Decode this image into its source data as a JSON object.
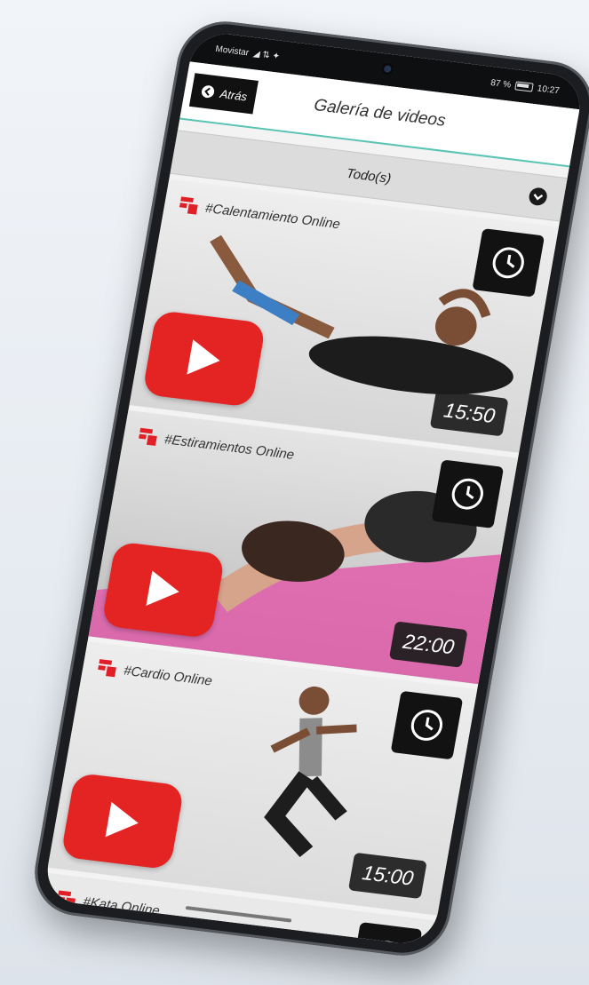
{
  "status_bar": {
    "carrier": "Movistar",
    "signal": "◢ ⇅ ✦",
    "battery": "87 %",
    "time": "10:27"
  },
  "app_bar": {
    "back_label": "Atrás",
    "title": "Galería de videos"
  },
  "filter": {
    "selected": "Todo(s)"
  },
  "videos": [
    {
      "tag": "#Calentamiento Online",
      "duration": "15:50"
    },
    {
      "tag": "#Estiramientos Online",
      "duration": "22:00"
    },
    {
      "tag": "#Cardio Online",
      "duration": "15:00"
    },
    {
      "tag": "#Kata Online",
      "duration": ""
    }
  ],
  "colors": {
    "accent_line": "#59c4b3",
    "play_red": "#e42323",
    "brand_red": "#e01f26",
    "dark": "#121212"
  },
  "icons": {
    "back": "back-arrow-icon",
    "filter": "chevron-down-circle-icon",
    "clock": "clock-icon",
    "play": "play-icon",
    "brand": "brand-logo-icon"
  }
}
